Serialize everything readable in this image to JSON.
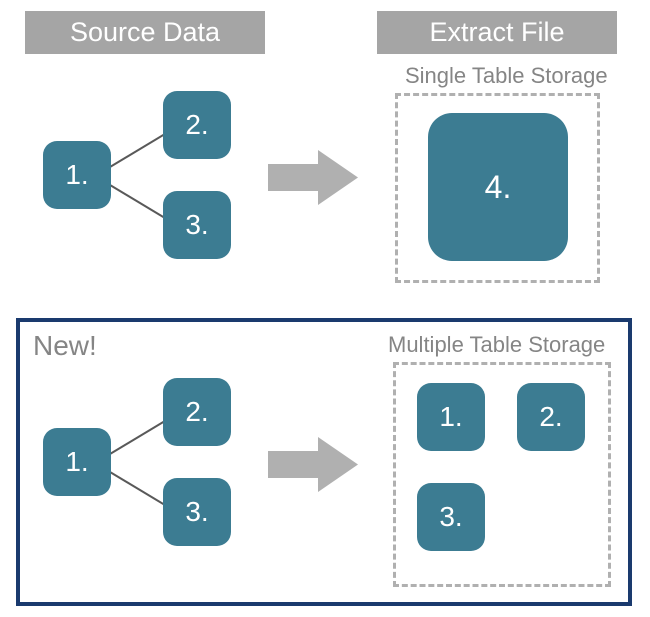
{
  "headers": {
    "source": "Source Data",
    "extract": "Extract File"
  },
  "labels": {
    "single_storage": "Single Table Storage",
    "multiple_storage": "Multiple Table Storage",
    "new": "New!"
  },
  "top": {
    "source_nodes": {
      "n1": "1.",
      "n2": "2.",
      "n3": "3."
    },
    "result_node": "4."
  },
  "bottom": {
    "source_nodes": {
      "n1": "1.",
      "n2": "2.",
      "n3": "3."
    },
    "result_nodes": {
      "n1": "1.",
      "n2": "2.",
      "n3": "3."
    }
  },
  "colors": {
    "box_fill": "#3c7c92",
    "header_fill": "#a5a5a5",
    "frame_border": "#1a3a6e",
    "dashed_border": "#b0b0b0",
    "arrow_fill": "#b0b0b0",
    "text_gray": "#858585"
  }
}
